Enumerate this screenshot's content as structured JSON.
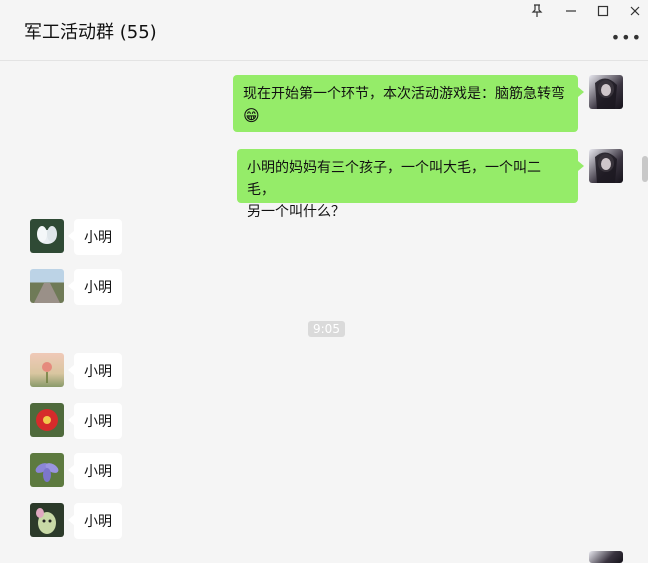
{
  "window": {
    "title": "军工活动群 (55)",
    "controls": {
      "pin": "pin-icon",
      "minimize": "minimize-icon",
      "maximize": "maximize-icon",
      "close": "close-icon",
      "more": "more-icon"
    }
  },
  "colors": {
    "self_bubble": "#95ec69",
    "other_bubble": "#ffffff",
    "background": "#f5f5f5"
  },
  "messages": [
    {
      "sender": "self",
      "text": "现在开始第一个环节，本次活动游戏是：脑筋急转弯",
      "emoji": "😁"
    },
    {
      "sender": "self",
      "text_line1": "小明的妈妈有三个孩子，一个叫大毛，一个叫二毛，",
      "text_line2": "另一个叫什么？"
    },
    {
      "sender": "other",
      "text": "小明"
    },
    {
      "sender": "other",
      "text": "小明"
    },
    {
      "time": "9:05"
    },
    {
      "sender": "other",
      "text": "小明"
    },
    {
      "sender": "other",
      "text": "小明"
    },
    {
      "sender": "other",
      "text": "小明"
    },
    {
      "sender": "other",
      "text": "小明"
    }
  ]
}
